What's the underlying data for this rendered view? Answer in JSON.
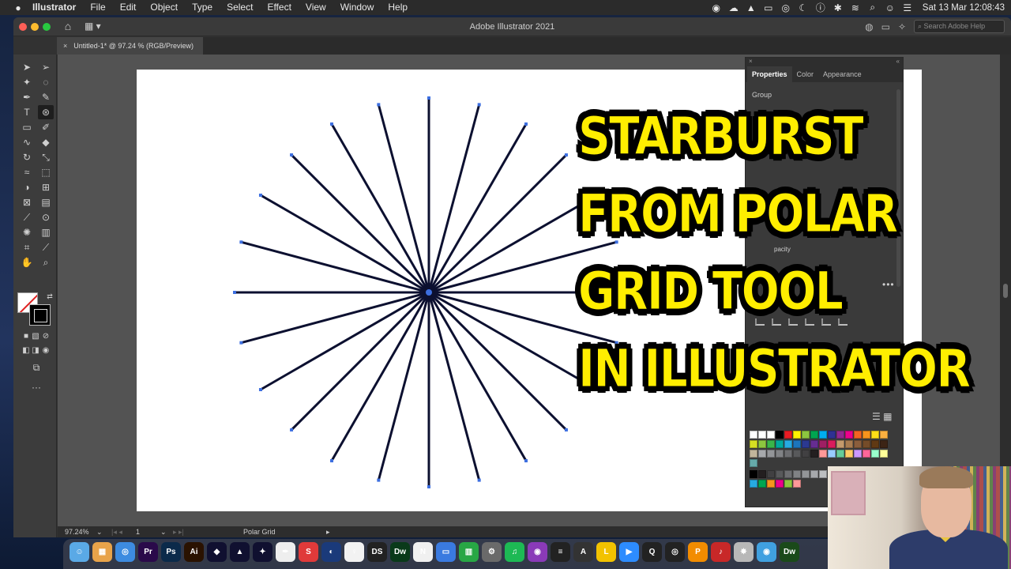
{
  "menubar": {
    "apple": "",
    "app_name": "Illustrator",
    "items": [
      "File",
      "Edit",
      "Object",
      "Type",
      "Select",
      "Effect",
      "View",
      "Window",
      "Help"
    ],
    "clock": "Sat 13 Mar  12:08:43"
  },
  "window": {
    "title": "Adobe Illustrator 2021",
    "search_placeholder": "Search Adobe Help",
    "doc_tab": "Untitled-1* @ 97.24 % (RGB/Preview)"
  },
  "properties_panel": {
    "tabs": [
      "Properties",
      "Color",
      "Appearance"
    ],
    "section_label": "Group",
    "opacity_label": "pacity"
  },
  "statusbar": {
    "zoom": "97.24%",
    "artboard_number": "1",
    "current_tool": "Polar Grid"
  },
  "overlay_title": {
    "lines": [
      "STARBURST",
      "FROM POLAR",
      "GRID TOOL",
      "IN ILLUSTRATOR"
    ]
  },
  "colors": {
    "title_yellow": "#ffee00",
    "line_stroke": "#0c1030",
    "anchor_blue": "#3d6fe0"
  },
  "dock": {
    "apps": [
      "Finder",
      "Launchpad",
      "Safari",
      "Premiere Pro",
      "Photoshop",
      "Illustrator",
      "Affinity Designer",
      "Affinity Photo",
      "Affinity Publisher",
      "Script Editor",
      "App",
      "Safari",
      "Anatomy",
      "DS",
      "Dreamweaver",
      "News",
      "Keynote",
      "Numbers",
      "System Preferences",
      "Spotify",
      "Podcasts",
      "Activity Monitor",
      "Analog Lab",
      "Live",
      "Zoom",
      "QuickTime",
      "OBS",
      "Pages",
      "App",
      "App",
      "App",
      "Dw"
    ]
  }
}
